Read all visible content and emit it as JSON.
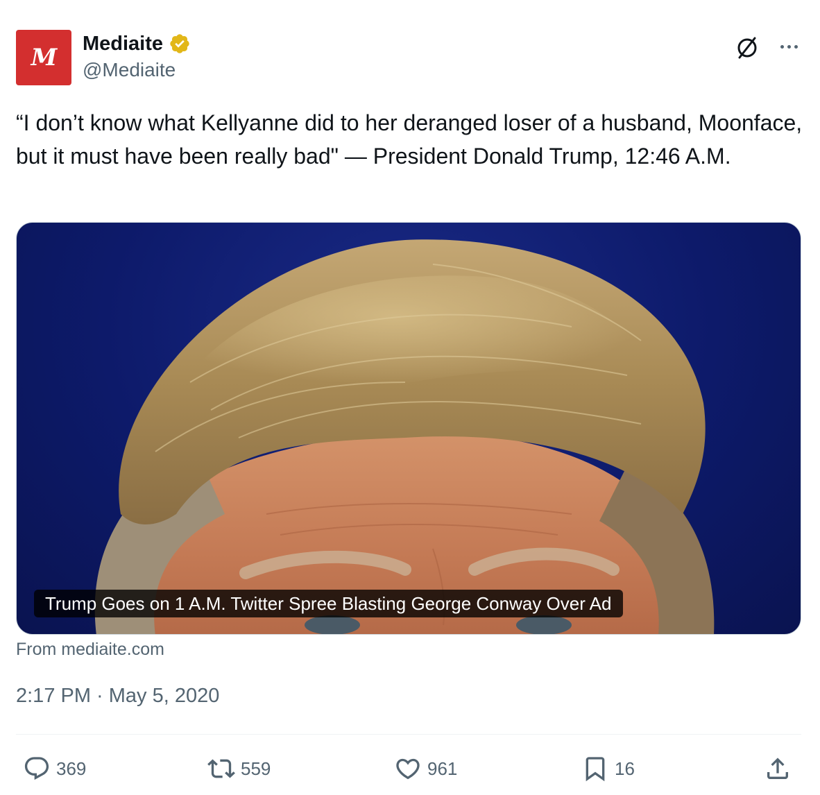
{
  "author": {
    "avatar_letter": "M",
    "display_name": "Mediaite",
    "handle": "@Mediaite",
    "verified_icon": "gold-verified-badge-icon",
    "avatar_color": "#d32f2f"
  },
  "tweet": {
    "text": "“I don’t know what Kellyanne did to her deranged loser of a husband, Moonface, but it must have been really bad\" — President Donald Trump, 12:46 A.M.",
    "timestamp": "2:17 PM · May 5, 2020"
  },
  "link_card": {
    "caption": "Trump Goes on 1 A.M. Twitter Spree Blasting George Conway Over Ad",
    "source": "From mediaite.com"
  },
  "actions": {
    "replies": "369",
    "retweets": "559",
    "likes": "961",
    "bookmarks": "16"
  },
  "icons": {
    "grok": "grok-icon",
    "more": "more-icon",
    "reply": "reply-icon",
    "retweet": "retweet-icon",
    "like": "heart-icon",
    "bookmark": "bookmark-icon",
    "share": "share-icon"
  },
  "colors": {
    "text_primary": "#0f1419",
    "text_secondary": "#536471",
    "verified_gold": "#e2b719"
  }
}
